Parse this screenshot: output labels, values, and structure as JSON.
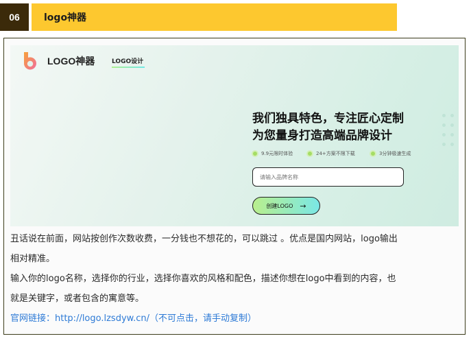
{
  "section": {
    "number": "06",
    "title": "logo神器"
  },
  "screenshot": {
    "brand": "LOGO神器",
    "nav_link": "LOGO设计",
    "headline_line1": "我们独具特色，专注匠心定制",
    "headline_line2": "为您量身打造高端品牌设计",
    "features": [
      "9.9元限时体验",
      "24+方案不限下载",
      "3分钟极速生成"
    ],
    "input_placeholder": "请输入品牌名称",
    "create_button": "创建LOGO",
    "colors": {
      "accent_green": "#b9ef8d",
      "accent_cyan": "#7ae7e6",
      "logo_orange": "#f6823a",
      "logo_pink": "#f06d9c"
    }
  },
  "description": {
    "para1_line1": "丑话说在前面，网站按创作次数收费，一分钱也不想花的，可以跳过 。优点是国内网站，logo输出",
    "para1_line2": "相对精准。",
    "para2_line1": "输入你的logo名称，选择你的行业，选择你喜欢的风格和配色，描述你想在logo中看到的内容，也",
    "para2_line2": "就是关键字，或者包含的寓意等。",
    "link_line": "官网链接：http://logo.lzsdyw.cn/（不可点击，请手动复制）"
  },
  "header_colors": {
    "number_bg": "#3b2a0a",
    "bar_bg": "#fdc82f"
  }
}
